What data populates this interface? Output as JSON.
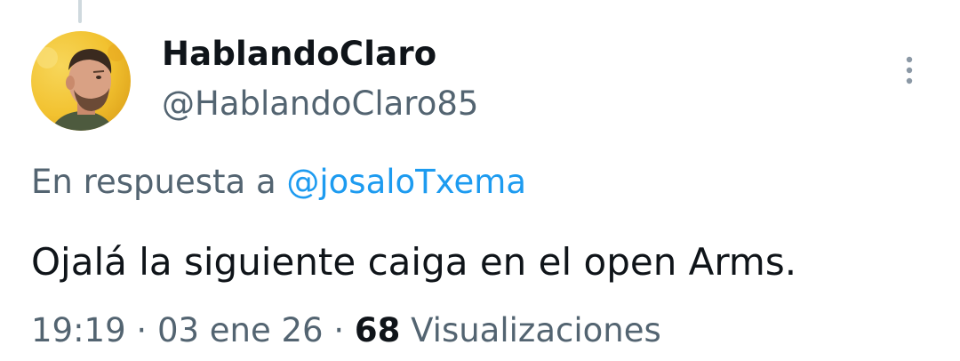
{
  "author": {
    "display_name": "HablandoClaro",
    "handle": "@HablandoClaro85",
    "avatar_icon": "profile-photo"
  },
  "reply": {
    "prefix": "En respuesta a",
    "mention": "@josaloTxema"
  },
  "tweet": {
    "text": "Ojalá la siguiente caiga en el open Arms."
  },
  "meta": {
    "time": "19:19",
    "separator": "·",
    "date": "03 ene 26",
    "views_count": "68",
    "views_label": "Visualizaciones"
  },
  "menu": {
    "icon": "more-vertical-icon"
  },
  "colors": {
    "text_primary": "#0f1419",
    "text_secondary": "#536471",
    "link": "#1d9bf0",
    "thread_line": "#cfd9de",
    "avatar_background": "#f2c230"
  }
}
